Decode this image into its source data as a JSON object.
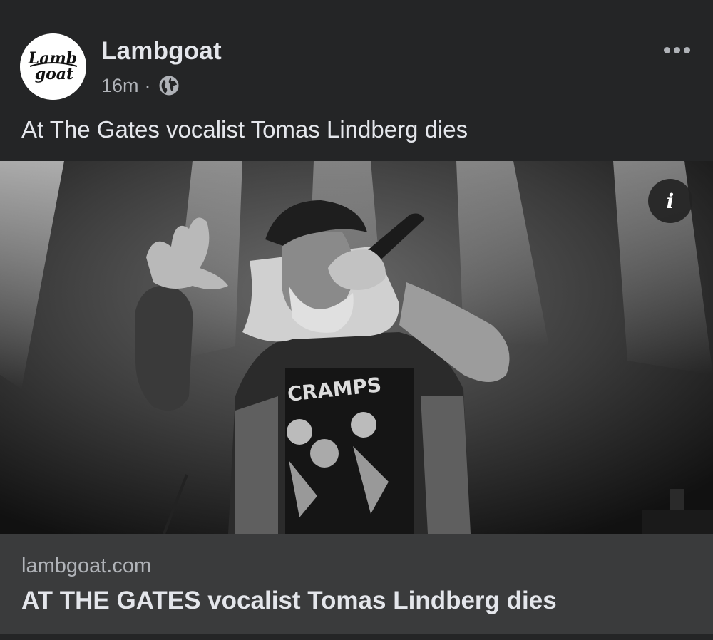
{
  "post": {
    "page_name": "Lambgoat",
    "avatar_text": "Lamb goat",
    "timestamp": "16m",
    "separator": "·",
    "audience_icon": "globe-icon",
    "more_icon": "more-dots-icon",
    "text": "At The Gates vocalist Tomas Lindberg dies"
  },
  "media": {
    "description_icon": "info-icon",
    "info_glyph": "i",
    "shirt_print": "CRAMPS"
  },
  "link_preview": {
    "domain": "lambgoat.com",
    "title": "AT THE GATES vocalist Tomas Lindberg dies"
  },
  "colors": {
    "background": "#242526",
    "preview_background": "#3a3b3c",
    "primary_text": "#e4e6eb",
    "secondary_text": "#b0b3b8"
  }
}
